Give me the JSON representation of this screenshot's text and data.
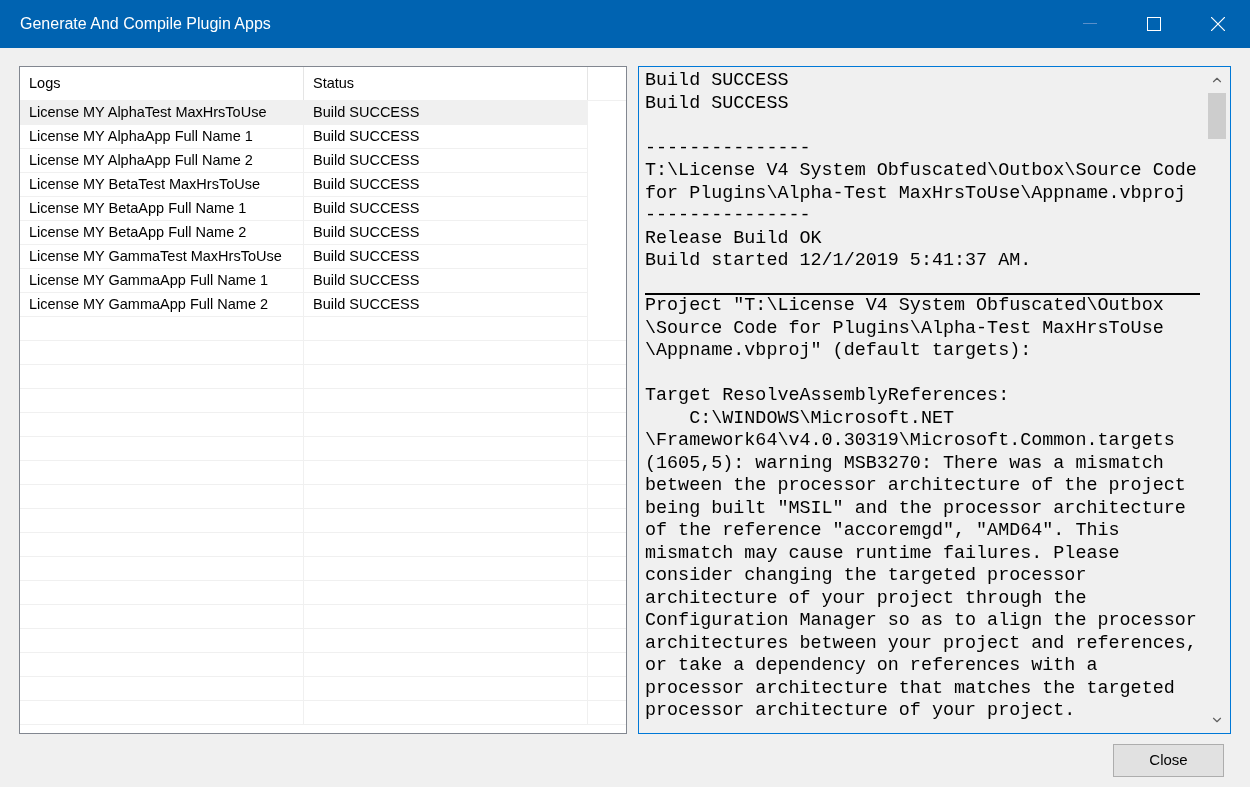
{
  "window": {
    "title": "Generate And Compile Plugin Apps"
  },
  "table": {
    "columns": [
      "Logs",
      "Status"
    ],
    "rows": [
      {
        "cells": [
          "License MY AlphaTest MaxHrsToUse",
          "Build SUCCESS"
        ],
        "selected": true
      },
      {
        "cells": [
          "License MY AlphaApp Full Name 1",
          "Build SUCCESS"
        ],
        "selected": false
      },
      {
        "cells": [
          "License MY AlphaApp Full Name 2",
          "Build SUCCESS"
        ],
        "selected": false
      },
      {
        "cells": [
          "License MY BetaTest MaxHrsToUse",
          "Build SUCCESS"
        ],
        "selected": false
      },
      {
        "cells": [
          "License MY BetaApp Full Name 1",
          "Build SUCCESS"
        ],
        "selected": false
      },
      {
        "cells": [
          "License MY BetaApp Full Name 2",
          "Build SUCCESS"
        ],
        "selected": false
      },
      {
        "cells": [
          "License MY GammaTest MaxHrsToUse",
          "Build SUCCESS"
        ],
        "selected": false
      },
      {
        "cells": [
          "License MY GammaApp Full Name 1",
          "Build SUCCESS"
        ],
        "selected": false
      },
      {
        "cells": [
          "License MY GammaApp Full Name 2",
          "Build SUCCESS"
        ],
        "selected": false
      }
    ]
  },
  "log": [
    {
      "kind": "line",
      "text": "Build SUCCESS"
    },
    {
      "kind": "line",
      "text": "Build SUCCESS"
    },
    {
      "kind": "blank"
    },
    {
      "kind": "line",
      "text": "---------------"
    },
    {
      "kind": "line",
      "text": "T:\\License V4 System Obfuscated\\Outbox\\Source Code"
    },
    {
      "kind": "line",
      "text": "for Plugins\\Alpha-Test MaxHrsToUse\\Appname.vbproj"
    },
    {
      "kind": "line",
      "text": "---------------"
    },
    {
      "kind": "line",
      "text": "Release Build OK"
    },
    {
      "kind": "line",
      "text": "Build started 12/1/2019 5:41:37 AM."
    },
    {
      "kind": "rule"
    },
    {
      "kind": "line",
      "text": "Project \"T:\\License V4 System Obfuscated\\Outbox"
    },
    {
      "kind": "line",
      "text": "\\Source Code for Plugins\\Alpha-Test MaxHrsToUse"
    },
    {
      "kind": "line",
      "text": "\\Appname.vbproj\" (default targets):"
    },
    {
      "kind": "blank"
    },
    {
      "kind": "line",
      "text": "Target ResolveAssemblyReferences:"
    },
    {
      "kind": "line",
      "text": "    C:\\WINDOWS\\Microsoft.NET"
    },
    {
      "kind": "line",
      "text": "\\Framework64\\v4.0.30319\\Microsoft.Common.targets"
    },
    {
      "kind": "line",
      "text": "(1605,5): warning MSB3270: There was a mismatch"
    },
    {
      "kind": "line",
      "text": "between the processor architecture of the project"
    },
    {
      "kind": "line",
      "text": "being built \"MSIL\" and the processor architecture"
    },
    {
      "kind": "line",
      "text": "of the reference \"accoremgd\", \"AMD64\". This"
    },
    {
      "kind": "line",
      "text": "mismatch may cause runtime failures. Please"
    },
    {
      "kind": "line",
      "text": "consider changing the targeted processor"
    },
    {
      "kind": "line",
      "text": "architecture of your project through the"
    },
    {
      "kind": "line",
      "text": "Configuration Manager so as to align the processor"
    },
    {
      "kind": "line",
      "text": "architectures between your project and references,"
    },
    {
      "kind": "line",
      "text": "or take a dependency on references with a"
    },
    {
      "kind": "line",
      "text": "processor architecture that matches the targeted"
    },
    {
      "kind": "line",
      "text": "processor architecture of your project."
    }
  ],
  "buttons": [
    {
      "label": "Close"
    }
  ]
}
